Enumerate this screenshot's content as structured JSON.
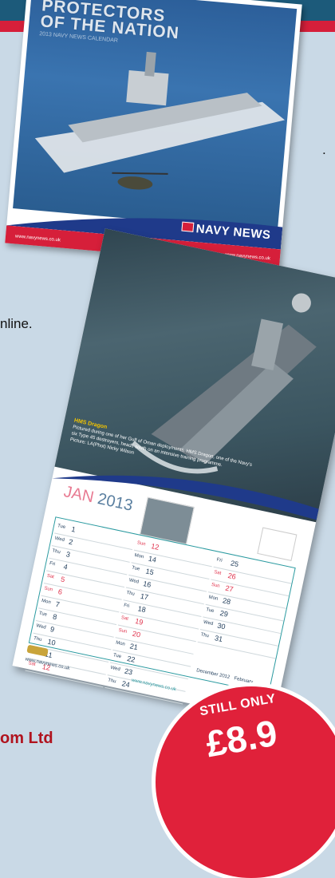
{
  "stray": {
    "dot": ".",
    "online": "nline.",
    "bottom_text": "om Ltd"
  },
  "calendar1": {
    "title_line1": "PROTECTORS",
    "title_line2": "OF THE NATION",
    "subtitle": "2013 NAVY NEWS CALENDAR",
    "brand": "NAVY NEWS",
    "url_left": "www.navynews.co.uk",
    "url_right": "www.navynews.co.uk"
  },
  "calendar2": {
    "caption_head": "HMS Dragon",
    "caption_body": "Pictured during one of her Gulf of Oman deployments, HMS Dragon, one of the Navy's six Type 45 destroyers, heads south on an intensive training programme.",
    "caption_credit": "Picture: LA(Phot) Nicky Wilson",
    "month": "JAN",
    "year": "2013",
    "columns": [
      [
        {
          "d": "Tue",
          "n": "1",
          "red": false
        },
        {
          "d": "Wed",
          "n": "2",
          "red": false
        },
        {
          "d": "Thu",
          "n": "3",
          "red": false
        },
        {
          "d": "Fri",
          "n": "4",
          "red": false
        },
        {
          "d": "Sat",
          "n": "5",
          "red": true
        },
        {
          "d": "Sun",
          "n": "6",
          "red": true
        },
        {
          "d": "Mon",
          "n": "7",
          "red": false
        },
        {
          "d": "Tue",
          "n": "8",
          "red": false
        },
        {
          "d": "Wed",
          "n": "9",
          "red": false
        },
        {
          "d": "Thu",
          "n": "10",
          "red": false
        }
      ],
      [
        {
          "d": "Sun",
          "n": "12",
          "red": true
        },
        {
          "d": "Mon",
          "n": "14",
          "red": false
        },
        {
          "d": "Tue",
          "n": "15",
          "red": false
        },
        {
          "d": "Wed",
          "n": "16",
          "red": false
        },
        {
          "d": "Thu",
          "n": "17",
          "red": false
        },
        {
          "d": "Fri",
          "n": "18",
          "red": false
        },
        {
          "d": "Sat",
          "n": "19",
          "red": true
        },
        {
          "d": "Sun",
          "n": "20",
          "red": true
        },
        {
          "d": "Mon",
          "n": "21",
          "red": false
        },
        {
          "d": "Tue",
          "n": "22",
          "red": false
        }
      ],
      [
        {
          "d": "Fri",
          "n": "25",
          "red": false
        },
        {
          "d": "Sat",
          "n": "26",
          "red": true
        },
        {
          "d": "Sun",
          "n": "27",
          "red": true
        },
        {
          "d": "Mon",
          "n": "28",
          "red": false
        },
        {
          "d": "Tue",
          "n": "29",
          "red": false
        },
        {
          "d": "Wed",
          "n": "30",
          "red": false
        },
        {
          "d": "Thu",
          "n": "31",
          "red": false
        }
      ]
    ],
    "extra_rows": [
      {
        "d": "Fri",
        "n": "11",
        "red": false
      },
      {
        "d": "Sat",
        "n": "12",
        "red": true
      },
      {
        "d": "Wed",
        "n": "23",
        "red": false
      },
      {
        "d": "Thu",
        "n": "24",
        "red": false
      }
    ],
    "mini_dec": "December 2012",
    "mini_feb": "February",
    "footer_url": "www.navynews.co.uk",
    "footer_order": "www.navynews.co.uk"
  },
  "promo": {
    "line1": "STILL ONLY",
    "price": "£8.9"
  }
}
